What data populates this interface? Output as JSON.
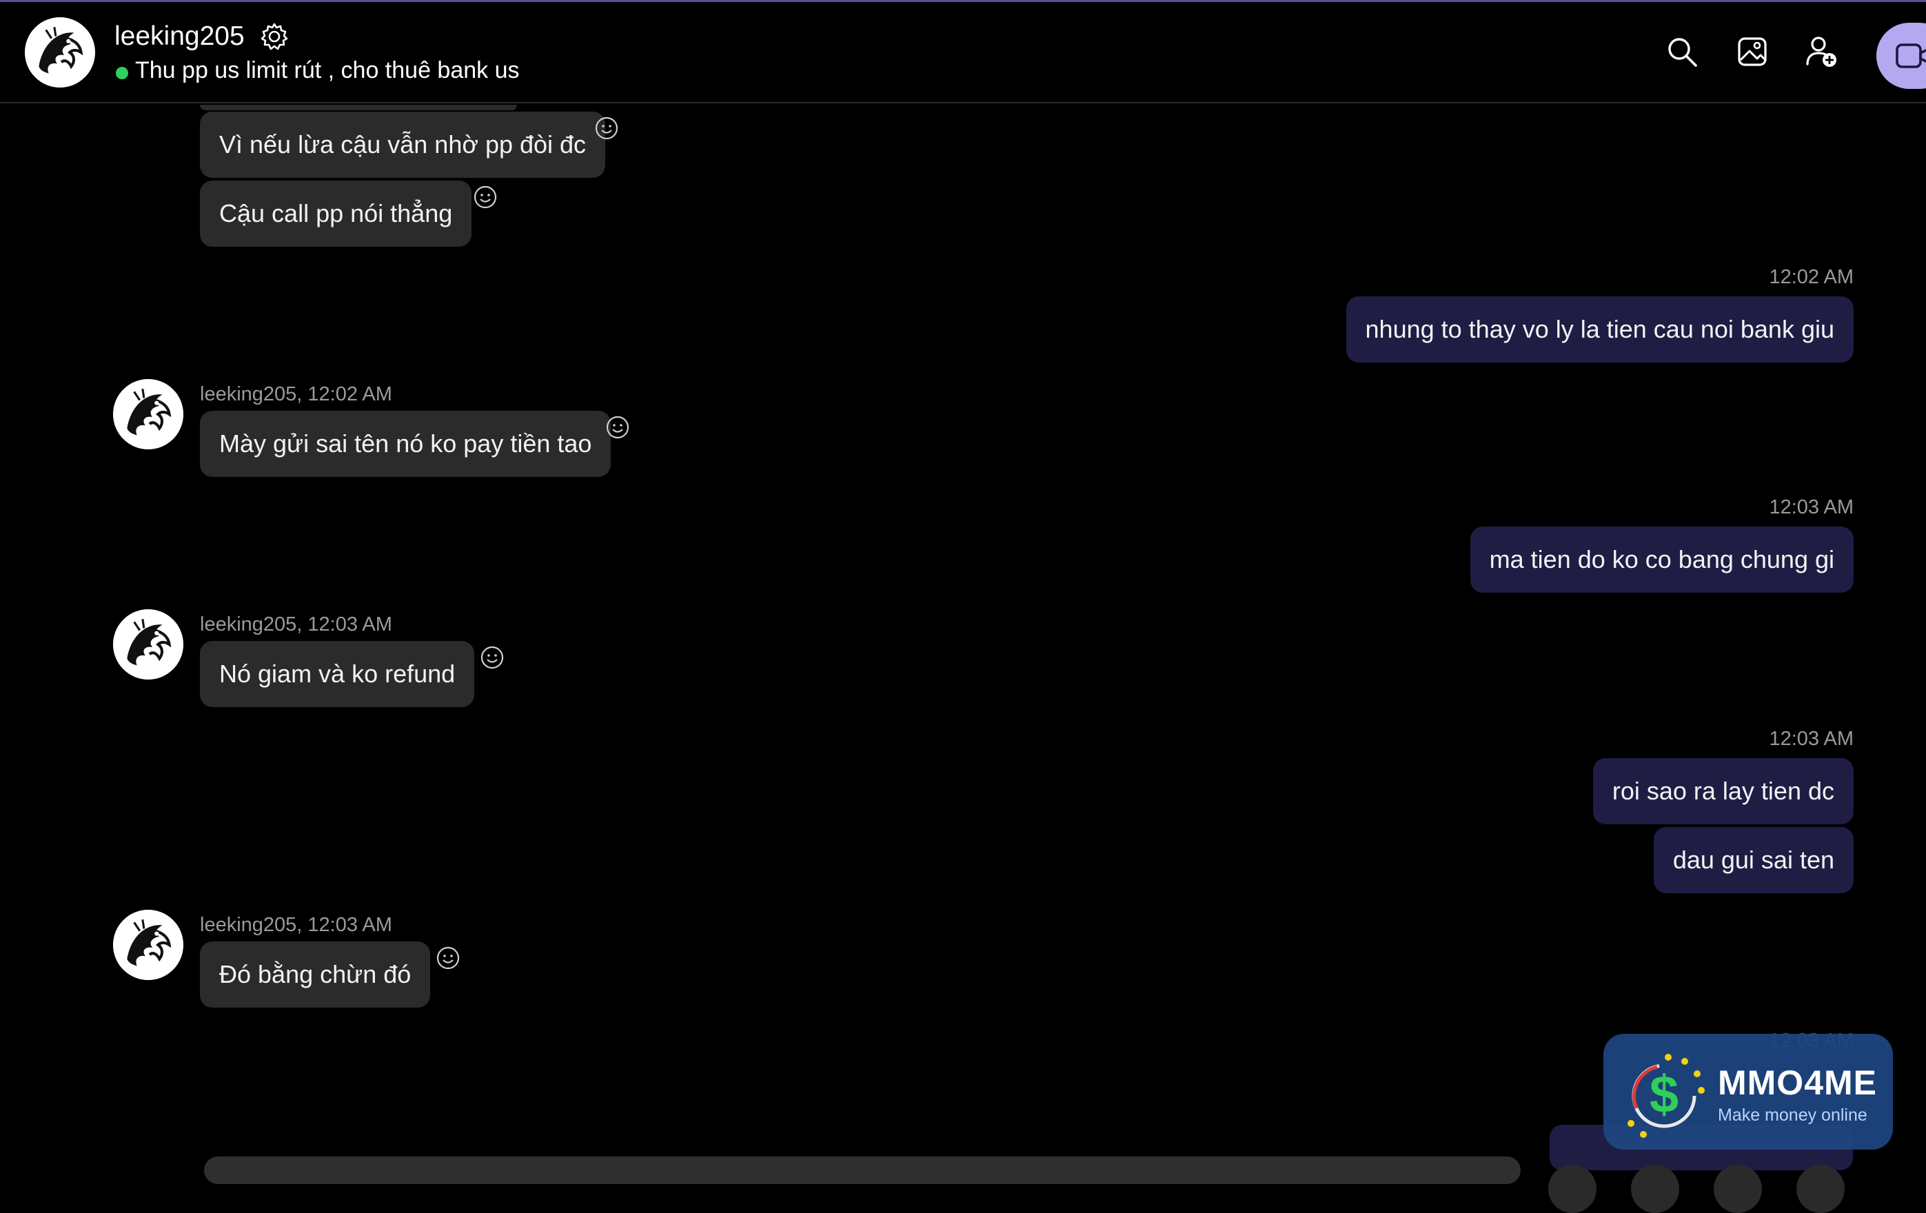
{
  "header": {
    "contact_name": "leeking205",
    "status_text": "Thu pp us limit rút , cho thuê bank us",
    "online": true,
    "icons": [
      "search-icon",
      "gallery-icon",
      "add-user-icon",
      "video-call-icon"
    ]
  },
  "messages": [
    {
      "dir": "in",
      "text": "Vì nếu lừa cậu vẫn nhờ pp đòi đc"
    },
    {
      "dir": "in",
      "text": "Cậu call pp nói thẳng"
    },
    {
      "dir": "out",
      "time": "12:02 AM",
      "text": "nhung to thay vo ly la tien cau noi bank giu"
    },
    {
      "dir": "in",
      "meta": "leeking205, 12:02 AM",
      "text": "Mày gửi sai tên nó ko pay tiền tao"
    },
    {
      "dir": "out",
      "time": "12:03 AM",
      "text": "ma tien do ko co bang chung gi"
    },
    {
      "dir": "in",
      "meta": "leeking205, 12:03 AM",
      "text": "Nó giam và ko refund"
    },
    {
      "dir": "out",
      "time": "12:03 AM",
      "text": "roi sao ra lay tien dc"
    },
    {
      "dir": "out",
      "text": "dau gui sai ten"
    },
    {
      "dir": "in",
      "meta": "leeking205, 12:03 AM",
      "text": "Đó bằng chừn đó"
    },
    {
      "dir": "out",
      "time": "12:03 AM"
    }
  ],
  "watermark": {
    "title": "MMO4ME",
    "subtitle": "Make money online"
  },
  "colors": {
    "background": "#000000",
    "incoming_bubble": "#2b2b2b",
    "outgoing_bubble": "#1f1d44",
    "accent": "#b4a8f0",
    "online_dot": "#2fcf5e"
  }
}
